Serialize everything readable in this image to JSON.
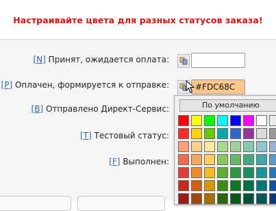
{
  "banner": {
    "title": "Настраивайте цвета для разных статусов заказа!"
  },
  "statuses": [
    {
      "letter": "N",
      "label": "Принят, ожидается оплата:",
      "color": ""
    },
    {
      "letter": "P",
      "label": "Оплачен, формируется к отправке:",
      "color": "#FDC68C"
    },
    {
      "letter": "B",
      "label": "Отправлено Директ-Сервис:"
    },
    {
      "letter": "T",
      "label": "Тестовый статус:"
    },
    {
      "letter": "F",
      "label": "Выполнен:"
    }
  ],
  "picker": {
    "default_label": "По умолчанию",
    "palette": [
      [
        "#ff0000",
        "#ffff00",
        "#00ff00",
        "#00ffff",
        "#0000ff",
        "#ff00ff",
        "#ffffff",
        "#ebebeb"
      ],
      [
        "#ff2a2a",
        "#ffd200",
        "#66cc00",
        "#00aaaa",
        "#3366cc",
        "#993399",
        "#dcdcdc",
        "#9a9a9a"
      ],
      [
        "#f9a07a",
        "#fbd08a",
        "#fbe89a",
        "#a8d88a",
        "#a0d0a0",
        "#88c8b0",
        "#8cc8c8",
        "#a0b0d0"
      ],
      [
        "#f26a4f",
        "#f7a858",
        "#fcd058",
        "#88c858",
        "#66b866",
        "#44a880",
        "#40a8a8",
        "#5a98c8"
      ],
      [
        "#e63b2e",
        "#f08a28",
        "#f5be1e",
        "#5ab02e",
        "#2a9a42",
        "#189060",
        "#129898",
        "#2878b8"
      ],
      [
        "#c82818",
        "#d06010",
        "#d89800",
        "#3c8a18",
        "#107820",
        "#007048",
        "#007878",
        "#1050a0"
      ],
      [
        "#9a1c10",
        "#a04808",
        "#a87000",
        "#286810",
        "#0a5818",
        "#005238",
        "#005858",
        "#0a3878"
      ]
    ]
  }
}
